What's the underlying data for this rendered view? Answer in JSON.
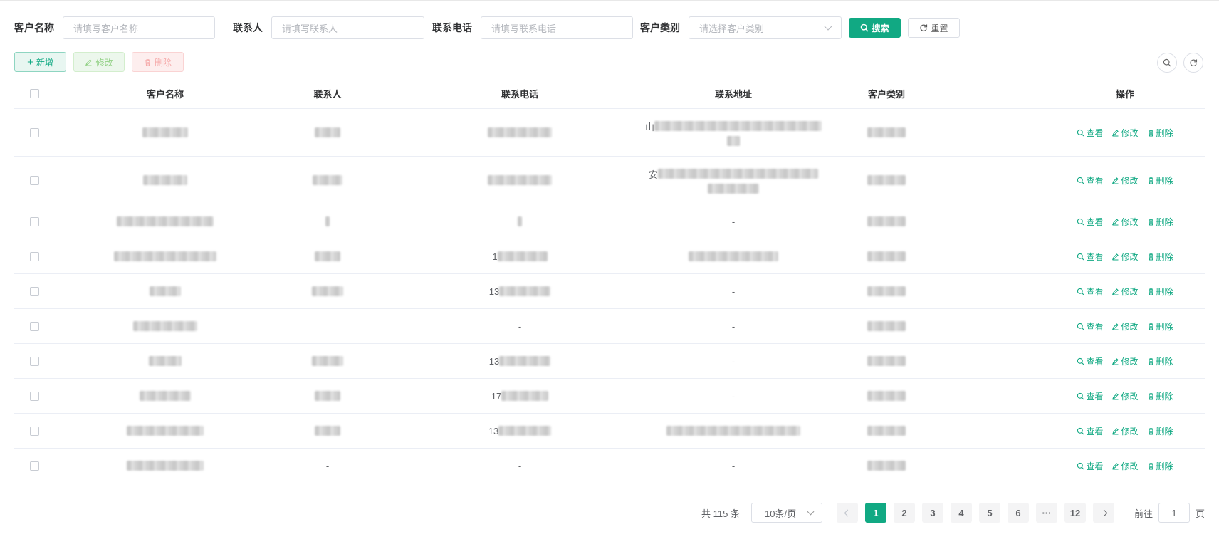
{
  "search": {
    "name_label": "客户名称",
    "name_placeholder": "请填写客户名称",
    "contact_label": "联系人",
    "contact_placeholder": "请填写联系人",
    "phone_label": "联系电话",
    "phone_placeholder": "请填写联系电话",
    "type_label": "客户类别",
    "type_placeholder": "请选择客户类别",
    "search_button": "搜索",
    "reset_button": "重置"
  },
  "toolbar": {
    "add_label": "新增",
    "edit_label": "修改",
    "delete_label": "删除"
  },
  "table": {
    "headers": {
      "name": "客户名称",
      "contact": "联系人",
      "phone": "联系电话",
      "address": "联系地址",
      "type": "客户类别",
      "ops": "操作"
    },
    "ops": {
      "view": "查看",
      "edit": "修改",
      "delete": "删除"
    },
    "rows": [
      {
        "phone_prefix": "",
        "phone_dash": "",
        "address_prefix": "山",
        "address_dash": "",
        "contact_dash": ""
      },
      {
        "phone_prefix": "",
        "phone_dash": "",
        "address_prefix": "安",
        "address_dash": "",
        "contact_dash": ""
      },
      {
        "phone_prefix": "",
        "phone_dash": "",
        "address_prefix": "",
        "address_dash": "-",
        "contact_dash": ""
      },
      {
        "phone_prefix": "1",
        "phone_dash": "",
        "address_prefix": "",
        "address_dash": "",
        "contact_dash": ""
      },
      {
        "phone_prefix": "13",
        "phone_dash": "",
        "address_prefix": "",
        "address_dash": "-",
        "contact_dash": ""
      },
      {
        "phone_prefix": "",
        "phone_dash": "-",
        "address_prefix": "",
        "address_dash": "-",
        "contact_dash": ""
      },
      {
        "phone_prefix": "13",
        "phone_dash": "",
        "address_prefix": "",
        "address_dash": "-",
        "contact_dash": ""
      },
      {
        "phone_prefix": "17",
        "phone_dash": "",
        "address_prefix": "",
        "address_dash": "-",
        "contact_dash": ""
      },
      {
        "phone_prefix": "13",
        "phone_dash": "",
        "address_prefix": "",
        "address_dash": "",
        "contact_dash": ""
      },
      {
        "phone_prefix": "",
        "phone_dash": "-",
        "address_prefix": "",
        "address_dash": "-",
        "contact_dash": "-"
      }
    ]
  },
  "pagination": {
    "total_text": "共 115 条",
    "page_size": "10条/页",
    "pages": [
      "1",
      "2",
      "3",
      "4",
      "5",
      "6",
      "···",
      "12"
    ],
    "current_page": "1",
    "goto_label": "前往",
    "goto_value": "1",
    "page_suffix": "页"
  },
  "colors": {
    "primary": "#11a983"
  }
}
